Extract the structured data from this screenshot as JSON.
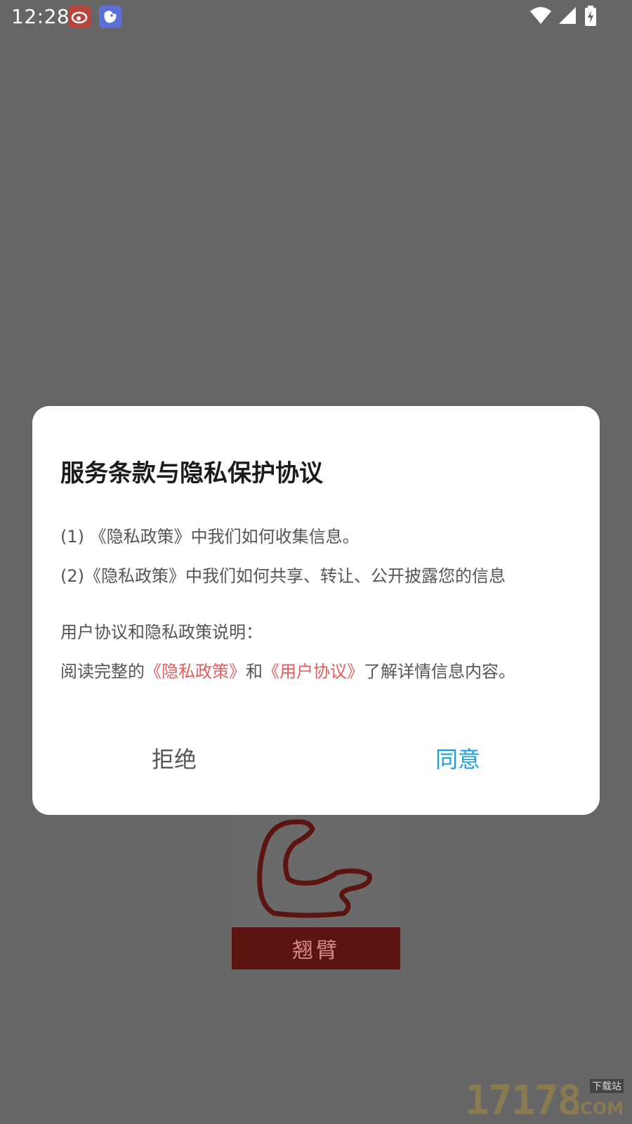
{
  "status_bar": {
    "time": "12:28",
    "icons": [
      "weibo-icon",
      "bird-app-icon",
      "wifi-icon",
      "signal-icon",
      "battery-charging-icon"
    ]
  },
  "background": {
    "logo_text": "翘臂",
    "watermark_number": "17178",
    "watermark_small": "下载站",
    "watermark_com": ".COM"
  },
  "dialog": {
    "title": "服务条款与隐私保护协议",
    "line1": "(1) 《隐私政策》中我们如何收集信息。",
    "line2": "(2)《隐私政策》中我们如何共享、转让、公开披露您的信息",
    "line3": "用户协议和隐私政策说明：",
    "line4": {
      "prefix": "阅读完整的",
      "privacy_link": "《隐私政策》",
      "middle": "和",
      "user_link": "《用户协议》",
      "suffix": "了解详情信息内容。"
    },
    "reject_label": "拒绝",
    "agree_label": "同意"
  },
  "colors": {
    "overlay": "#666666",
    "link_red": "#e55d5d",
    "agree_blue": "#1aa0df",
    "dialog_bg": "#ffffff"
  }
}
